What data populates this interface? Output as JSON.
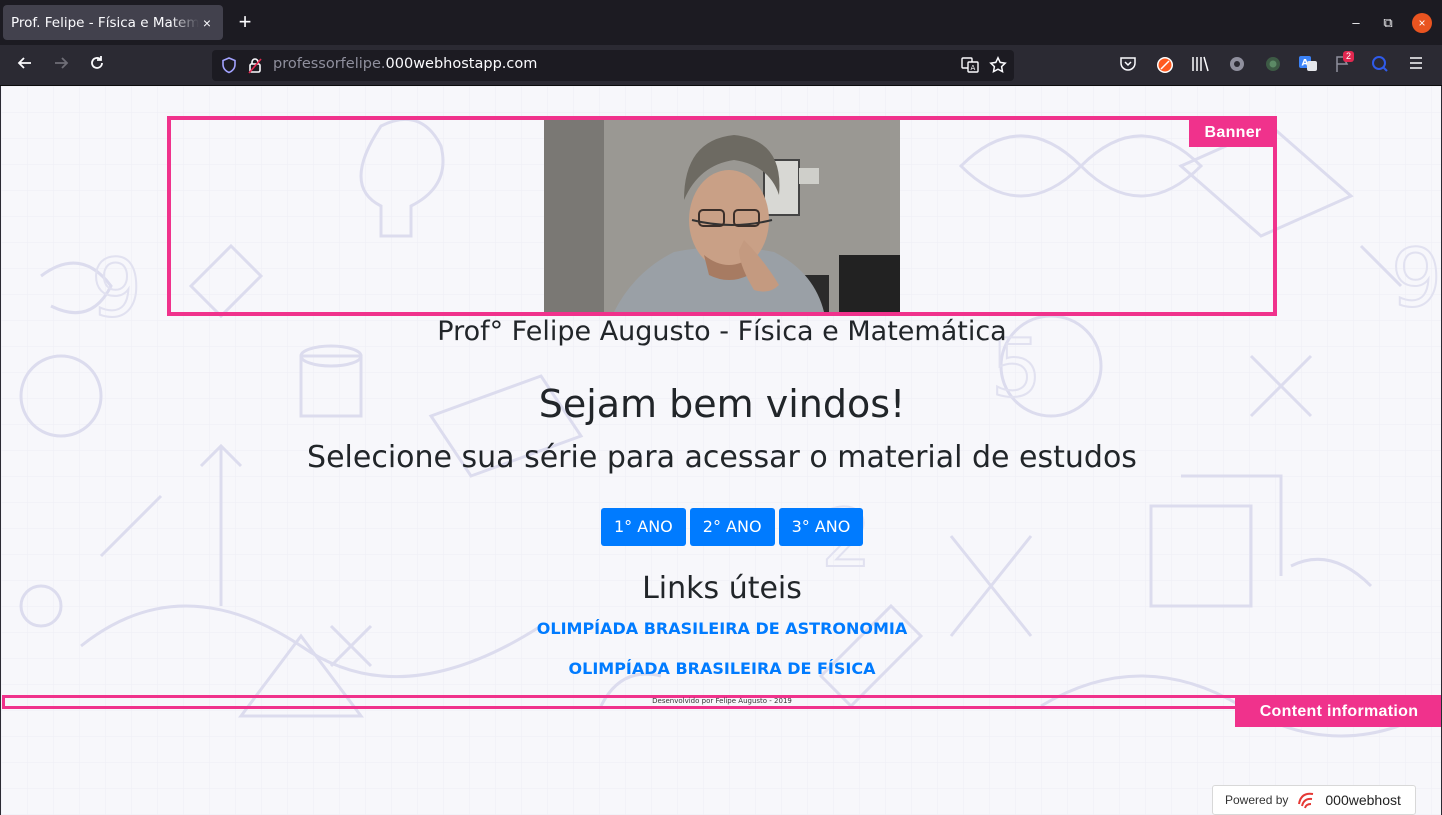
{
  "browser": {
    "tab_title": "Prof. Felipe - Física e Matemática",
    "tab_close": "×",
    "new_tab": "+",
    "url_prefix": "professorfelipe.",
    "url_host": "000webhostapp.com",
    "notification_badge": "2",
    "win_minimize": "–",
    "win_restore": "⧉",
    "win_close": "×"
  },
  "page": {
    "banner_tag": "Banner",
    "site_title": "Prof° Felipe Augusto - Física e Matemática",
    "welcome": "Sejam bem vindos!",
    "subtitle": "Selecione sua série para acessar o material de estudos",
    "year_buttons": [
      "1° ANO",
      "2° ANO",
      "3° ANO"
    ],
    "links_title": "Links úteis",
    "links": [
      "OLIMPÍADA BRASILEIRA DE ASTRONOMIA",
      "OLIMPÍADA BRASILEIRA DE FÍSICA"
    ],
    "footer_text": "Desenvolvido por Felipe Augusto - 2019",
    "footer_tag": "Content information",
    "powered_by": "Powered by",
    "powered_brand": "000webhost"
  },
  "colors": {
    "accent_highlight": "#f0328c",
    "button_blue": "#007bff",
    "link_blue": "#007bff"
  }
}
